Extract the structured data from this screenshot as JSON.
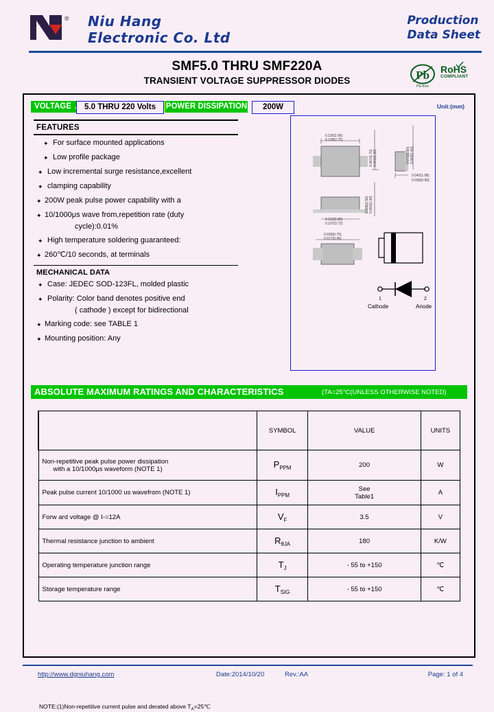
{
  "header": {
    "company_line1": "Niu Hang",
    "company_line2": "Electronic Co. Ltd",
    "logo_text": "NH",
    "registered_mark": "®",
    "prod_line1": "Production",
    "prod_line2": "Data Sheet"
  },
  "title": "SMF5.0 THRU SMF220A",
  "subtitle": "TRANSIENT VOLTAGE SUPPRESSOR DIODES",
  "certs": {
    "pb_label": "Pb",
    "pb_sub": "Pb-free",
    "rohs_label": "RoHS",
    "rohs_sub": "COMPLIANT"
  },
  "badges": {
    "voltage_label": "VOLTAGE",
    "voltage_value": "5.0 THRU 220 Volts",
    "power_label": "POWER DISSIPATION",
    "power_value": "200W",
    "package": "SOD-123FL",
    "unit": "Unit:(mm)"
  },
  "features": {
    "heading": "FEATURES",
    "items": [
      "For surface mounted applications",
      "Low profile package",
      "Low incremental surge resistance,excellent",
      "clamping capability",
      "200W peak pulse power capability with a",
      "10/1000μs wave from,repetition rate (duty",
      "High temperature soldering guaranteed:",
      "260℃/10 seconds, at terminals"
    ],
    "sub_item": "cycle):0.01%"
  },
  "mechanical": {
    "heading": "MECHANICAL DATA",
    "items": [
      "Case:  JEDEC SOD-123FL, molded plastic",
      "Polarity: Color band denotes positive end",
      "Marking code:  see TABLE 1",
      "Mounting position: Any"
    ],
    "polarity_cont": "( cathode ) except for bidirectional"
  },
  "drawing": {
    "dim_top_width_in": "0.115(2.90)",
    "dim_top_width_mm": "0.108(2.75)",
    "dim_top_height_1": "0.067(1.70)",
    "dim_top_height_2": "0.061(1.55)",
    "dim_side_height_1": "0.071(1.80)",
    "dim_side_height_2": "0.063(1.60)",
    "dim_side_width_1": "0.043(1.10)",
    "dim_side_width_2": "0.035(0.90)",
    "dim_mid_height_1": "0.098(2.50)",
    "dim_mid_height_2": "0.091(2.30)",
    "dim_mid_width_1": "0.112(2.85)",
    "dim_mid_width_2": "0.107(2.72)",
    "dim_bot_1": "0.030(0.75)",
    "dim_bot_2": "0.017(0.45)",
    "pin1_num": "1",
    "pin1_label": "Cathode",
    "pin2_num": "2",
    "pin2_label": "Anode"
  },
  "ratings": {
    "heading": "ABSOLUTE MAXIMUM RATINGS AND CHARACTERISTICS",
    "condition": "(TA=25°C(UNLESS OTHERWISE NOTED)",
    "columns": [
      "",
      "SYMBOL",
      "VALUE",
      "UNITS"
    ],
    "rows": [
      {
        "desc_line1": "Non-repetitive peak pulse power dissipation",
        "desc_line2": "with a 10/1000μs waveform (NOTE 1)",
        "symbol_main": "P",
        "symbol_sub": "PPM",
        "value_line1": "200",
        "value_line2": "",
        "units": "W"
      },
      {
        "desc_line1": "Peak pulse current 10/1000 us wavefrom (NOTE 1)",
        "desc_line2": "",
        "symbol_main": "I",
        "symbol_sub": "PPM",
        "value_line1": "See",
        "value_line2": "Table1",
        "units": "A"
      },
      {
        "desc_line1": "Forw ard voltage @ I-=12A",
        "desc_line2": "",
        "symbol_main": "V",
        "symbol_sub": "F",
        "value_line1": "3.5",
        "value_line2": "",
        "units": "V"
      },
      {
        "desc_line1": "Thermal resistance junction to ambient",
        "desc_line2": "",
        "symbol_main": "R",
        "symbol_sub": "θJA",
        "value_line1": "180",
        "value_line2": "",
        "units": "K/W"
      },
      {
        "desc_line1": "Operating  temperature junction range",
        "desc_line2": "",
        "symbol_main": "T",
        "symbol_sub": "J",
        "value_line1": "- 55 to +150",
        "value_line2": "",
        "units": "℃"
      },
      {
        "desc_line1": "Storage temperature range",
        "desc_line2": "",
        "symbol_main": "T",
        "symbol_sub": "SIG",
        "value_line1": "- 55 to +150",
        "value_line2": "",
        "units": "℃"
      }
    ],
    "note_prefix": "NOTE:(1)Non-repetitive current pulse and derated above T",
    "note_sub": "A",
    "note_suffix": "=25℃"
  },
  "footer": {
    "url": "http://www.dgniuhang.com",
    "date": "Date:2014/10/20",
    "rev": "Rev.:AA",
    "page": "Page: 1 of 4"
  },
  "colors": {
    "green": "#00c400",
    "blue": "#1a3a8f",
    "bg": "#f9eef5"
  }
}
